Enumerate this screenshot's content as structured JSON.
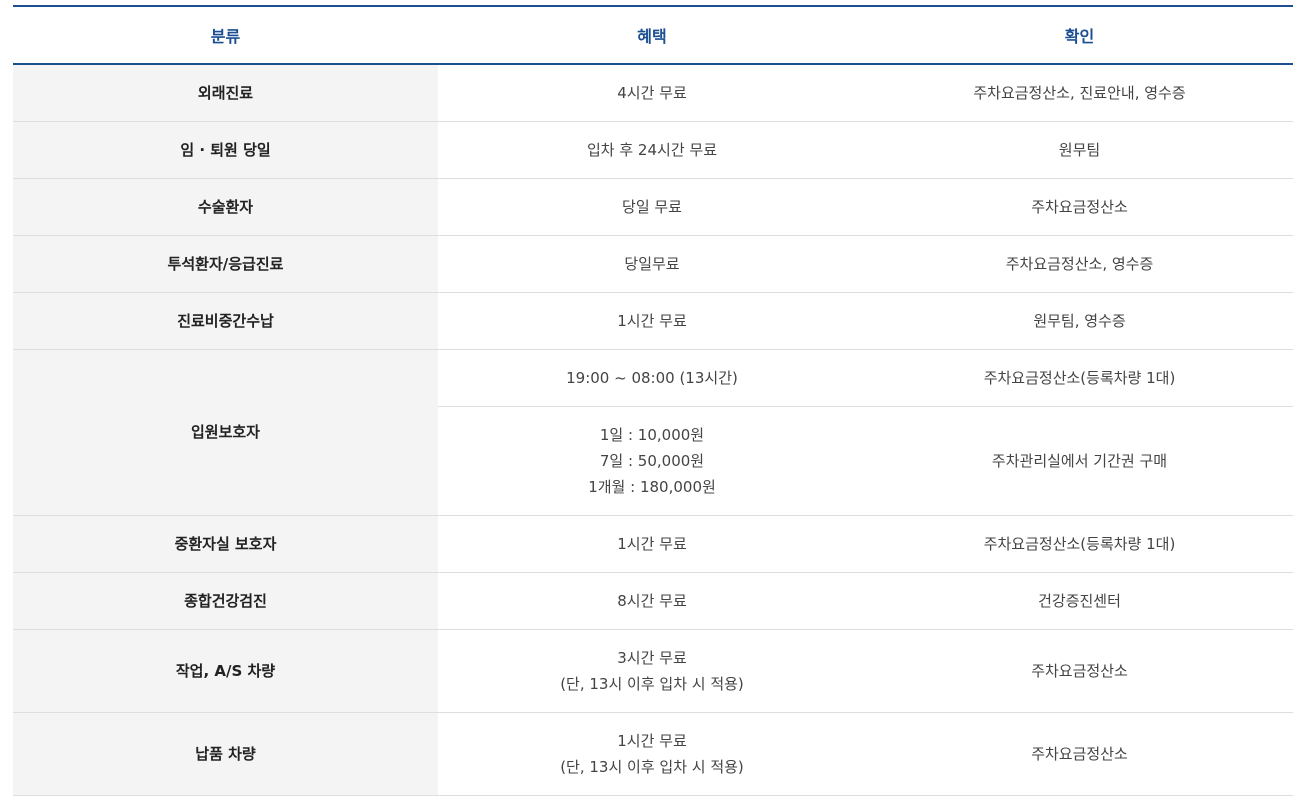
{
  "headers": {
    "category": "분류",
    "benefit": "혜택",
    "verify": "확인"
  },
  "rows": [
    {
      "category": "외래진료",
      "benefit": [
        "4시간 무료"
      ],
      "verify": "주차요금정산소, 진료안내, 영수증"
    },
    {
      "category": "임 · 퇴원 당일",
      "benefit": [
        "입차 후 24시간 무료"
      ],
      "verify": "원무팀"
    },
    {
      "category": "수술환자",
      "benefit": [
        "당일 무료"
      ],
      "verify": "주차요금정산소"
    },
    {
      "category": "투석환자/응급진료",
      "benefit": [
        "당일무료"
      ],
      "verify": "주차요금정산소, 영수증"
    },
    {
      "category": "진료비중간수납",
      "benefit": [
        "1시간 무료"
      ],
      "verify": "원무팀, 영수증"
    },
    {
      "category": "입원보호자",
      "benefit": [
        "19:00 ~ 08:00 (13시간)"
      ],
      "verify": "주차요금정산소(등록차량 1대)"
    },
    {
      "category": "",
      "benefit": [
        "1일 : 10,000원",
        "7일 : 50,000원",
        "1개월 : 180,000원"
      ],
      "verify": "주차관리실에서 기간권 구매"
    },
    {
      "category": "중환자실 보호자",
      "benefit": [
        "1시간 무료"
      ],
      "verify": "주차요금정산소(등록차량 1대)"
    },
    {
      "category": "종합건강검진",
      "benefit": [
        "8시간 무료"
      ],
      "verify": "건강증진센터"
    },
    {
      "category": "작업, A/S 차량",
      "benefit": [
        "3시간 무료",
        "(단, 13시 이후 입차 시 적용)"
      ],
      "verify": "주차요금정산소"
    },
    {
      "category": "납품 차량",
      "benefit": [
        "1시간 무료",
        "(단, 13시 이후 입차 시 적용)"
      ],
      "verify": "주차요금정산소"
    }
  ],
  "colors": {
    "header_border": "#1b4f91",
    "header_text": "#1b4f91",
    "category_bg": "#f4f4f4",
    "row_border": "#dedede"
  }
}
